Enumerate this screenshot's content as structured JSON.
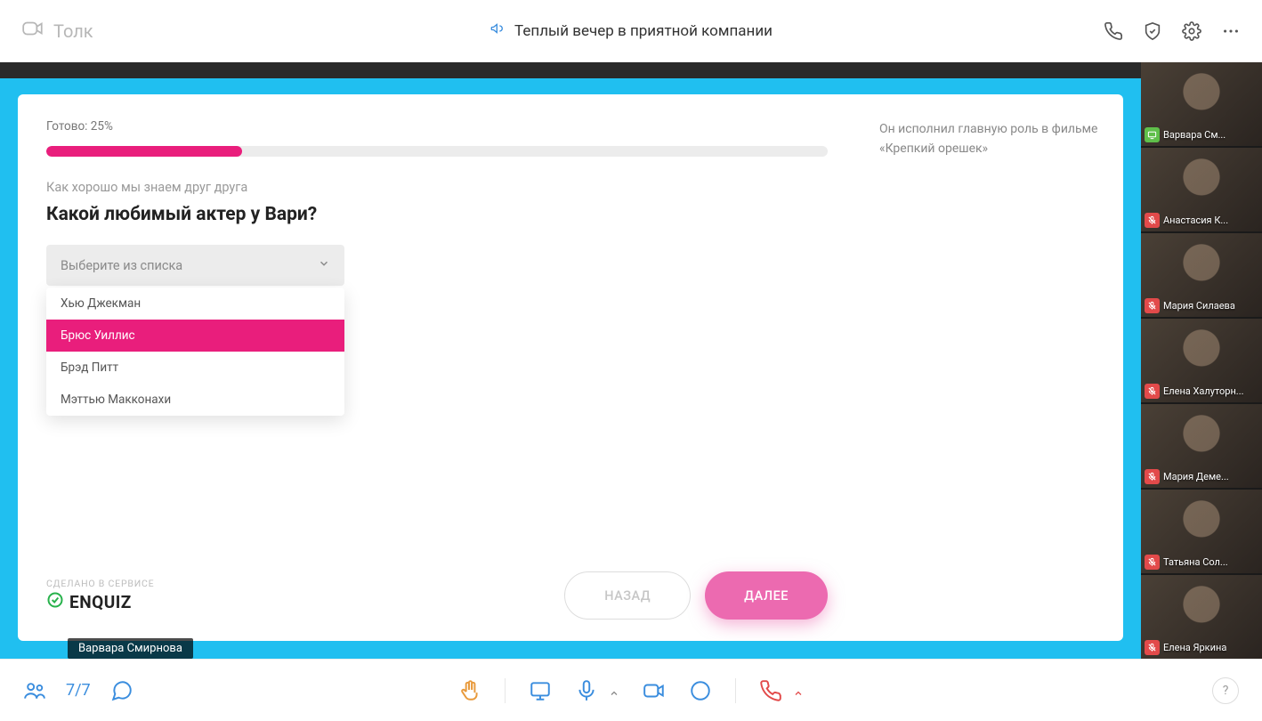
{
  "app_name": "Толк",
  "meeting_title": "Теплый вечер в приятной компании",
  "quiz": {
    "progress_label": "Готово: 25%",
    "progress_percent": 25,
    "subtitle": "Как хорошо мы знаем друг друга",
    "question": "Какой любимый актер у Вари?",
    "select_placeholder": "Выберите из списка",
    "options": [
      "Хью Джекман",
      "Брюс Уиллис",
      "Брэд Питт",
      "Мэттью Макконахи"
    ],
    "active_option_index": 1,
    "hint": "Он исполнил главную роль в фильме «Крепкий орешек»",
    "back_label": "НАЗАД",
    "next_label": "ДАЛЕЕ",
    "brand_note": "СДЕЛАНО В СЕРВИСЕ",
    "brand_name": "ENQUIZ"
  },
  "presenter_name": "Варвара Смирнова",
  "participants_strip": [
    {
      "name": "Варвара См...",
      "status": "sharing"
    },
    {
      "name": "Анастасия К...",
      "status": "muted"
    },
    {
      "name": "Мария Силаева",
      "status": "muted"
    },
    {
      "name": "Елена Халуторн...",
      "status": "muted"
    },
    {
      "name": "Мария Деме...",
      "status": "muted"
    },
    {
      "name": "Татьяна Сол...",
      "status": "muted"
    },
    {
      "name": "Елена Яркина",
      "status": "muted"
    }
  ],
  "bottombar": {
    "participant_count": "7/7",
    "help_label": "?"
  }
}
